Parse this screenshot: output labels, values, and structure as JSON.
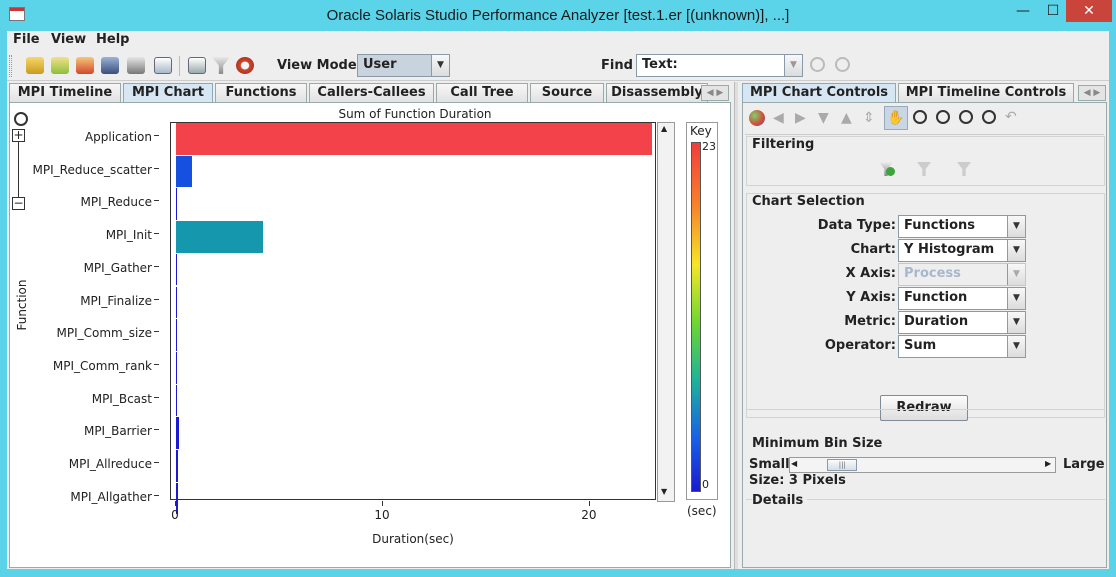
{
  "window": {
    "title": "Oracle Solaris Studio Performance Analyzer [test.1.er [(unknown)], ...]",
    "minimize": "—",
    "maximize": "☐",
    "close": "✕"
  },
  "menu": {
    "file": "File",
    "view": "View",
    "help": "Help"
  },
  "toolbar": {
    "view_mode_label": "View Mode",
    "view_mode_value": "User",
    "find_label": "Find",
    "find_type": "Text:",
    "find_value": ""
  },
  "left_tabs": [
    "MPI Timeline",
    "MPI Chart",
    "Functions",
    "Callers-Callees",
    "Call Tree",
    "Source",
    "Disassembly"
  ],
  "right_tabs": [
    "MPI Chart Controls",
    "MPI Timeline Controls"
  ],
  "controls": {
    "filtering": "Filtering",
    "chart_selection": "Chart Selection",
    "fields": [
      {
        "label": "Data Type:",
        "value": "Functions",
        "disabled": false
      },
      {
        "label": "Chart:",
        "value": "Y Histogram",
        "disabled": false
      },
      {
        "label": "X Axis:",
        "value": "Process",
        "disabled": true
      },
      {
        "label": "Y Axis:",
        "value": "Function",
        "disabled": false
      },
      {
        "label": "Metric:",
        "value": "Duration",
        "disabled": false
      },
      {
        "label": "Operator:",
        "value": "Sum",
        "disabled": false
      }
    ],
    "redraw": "Redraw",
    "min_bin_size": "Minimum Bin Size",
    "small": "Small",
    "large": "Large",
    "size_text": "Size: 3 Pixels",
    "slider_fraction": 0.12,
    "details": "Details"
  },
  "chart_data": {
    "type": "bar",
    "orientation": "horizontal",
    "title": "Sum of Function Duration",
    "xlabel": "Duration(sec)",
    "ylabel": "Function",
    "xlim": [
      0,
      23
    ],
    "xticks": [
      "0",
      "10",
      "20"
    ],
    "xtick_values": [
      0,
      10,
      20
    ],
    "categories": [
      "Application",
      "MPI_Reduce_scatter",
      "MPI_Reduce",
      "MPI_Init",
      "MPI_Gather",
      "MPI_Finalize",
      "MPI_Comm_size",
      "MPI_Comm_rank",
      "MPI_Bcast",
      "MPI_Barrier",
      "MPI_Allreduce",
      "MPI_Allgather"
    ],
    "values": [
      23.0,
      0.75,
      0.0,
      4.2,
      0.0,
      0.0,
      0.0,
      0.0,
      0.0,
      0.15,
      0.05,
      0.1
    ],
    "colors": [
      "#f4424b",
      "#1650e0",
      "#1a1ad2",
      "#1597ae",
      "#1a1ad2",
      "#1a1ad2",
      "#1a1ad2",
      "#1a1ad2",
      "#1a1ad2",
      "#1a1ad2",
      "#1a1ad2",
      "#1a1ad2"
    ],
    "legend": {
      "title": "Key",
      "max": "23",
      "min": "0",
      "unit": "(sec)"
    }
  }
}
